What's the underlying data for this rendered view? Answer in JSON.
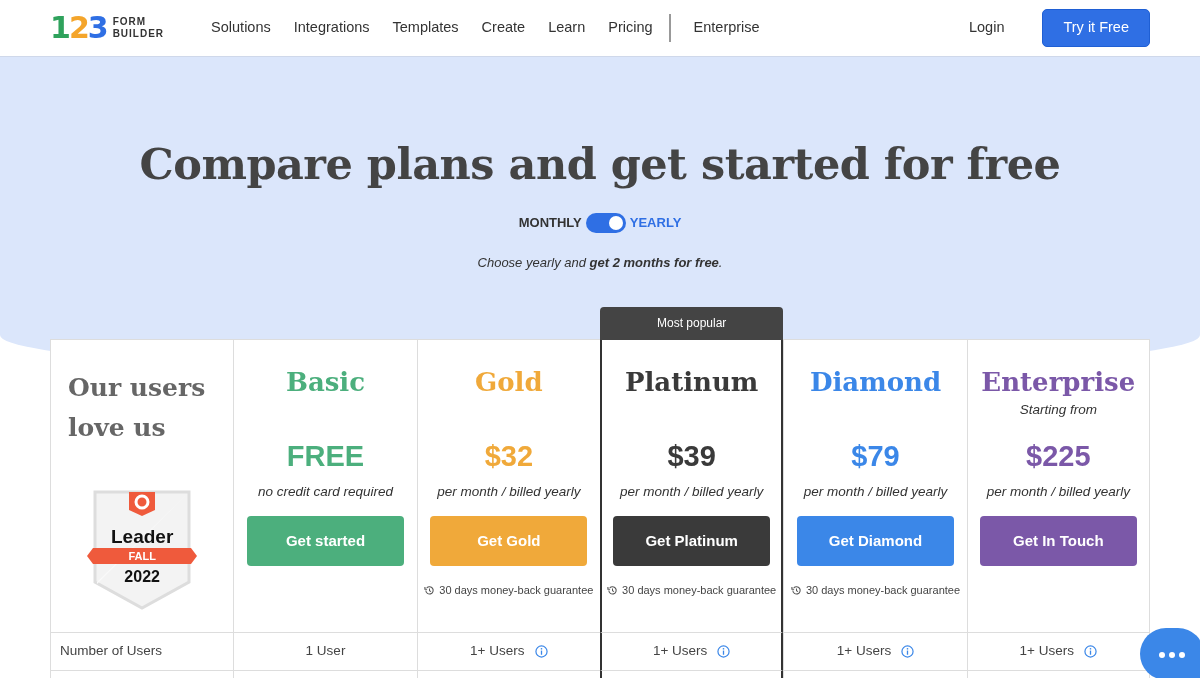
{
  "logo": {
    "digits": [
      {
        "text": "1",
        "color": "#2fa25c"
      },
      {
        "text": "2",
        "color": "#f4a52b"
      },
      {
        "text": "3",
        "color": "#2f6fe4"
      }
    ],
    "words": [
      "FORM",
      "BUILDER"
    ]
  },
  "nav": [
    {
      "label": "Solutions",
      "divider_before": false
    },
    {
      "label": "Integrations",
      "divider_before": false
    },
    {
      "label": "Templates",
      "divider_before": false
    },
    {
      "label": "Create",
      "divider_before": false
    },
    {
      "label": "Learn",
      "divider_before": false
    },
    {
      "label": "Pricing",
      "divider_before": false
    },
    {
      "label": "Enterprise",
      "divider_before": true
    }
  ],
  "login": "Login",
  "cta": "Try it Free",
  "hero": {
    "title": "Compare plans and get started for free",
    "billing": [
      {
        "label": "MONTHLY",
        "selected": false
      },
      {
        "label": "YEARLY",
        "selected": true
      }
    ],
    "note": "Choose yearly and **get 2 months for free**."
  },
  "intro": {
    "heading": "Our users love us",
    "badge": {
      "title": "Leader",
      "season": "FALL",
      "year": "2022"
    }
  },
  "plans": [
    {
      "name": "Basic",
      "color": "#4caf7d",
      "price": "FREE",
      "note": "no credit card required",
      "button": "Get started",
      "popular": false
    },
    {
      "name": "Gold",
      "color": "#f0a93a",
      "price": "$32",
      "note": "per month / billed yearly",
      "button": "Get Gold",
      "guarantee": "30 days money-back guarantee",
      "popular": false
    },
    {
      "name": "Platinum",
      "color": "#3a3a3a",
      "price": "$39",
      "note": "per month / billed yearly",
      "button": "Get Platinum",
      "guarantee": "30 days money-back guarantee",
      "popular": true,
      "popular_label": "Most popular"
    },
    {
      "name": "Diamond",
      "color": "#3b87e8",
      "price": "$79",
      "note": "per month / billed yearly",
      "button": "Get Diamond",
      "guarantee": "30 days money-back guarantee",
      "popular": false
    },
    {
      "name": "Enterprise",
      "color": "#7b58a8",
      "prefix": "Starting from",
      "price": "$225",
      "note": "per month / billed yearly",
      "button": "Get In Touch",
      "popular": false
    }
  ],
  "rows": [
    {
      "label": "Number of Users",
      "values": [
        {
          "text": "1 User",
          "info": false
        },
        {
          "text": "1+ Users",
          "info": true
        },
        {
          "text": "1+ Users",
          "info": true
        },
        {
          "text": "1+ Users",
          "info": true
        },
        {
          "text": "1+ Users",
          "info": true
        }
      ]
    }
  ]
}
